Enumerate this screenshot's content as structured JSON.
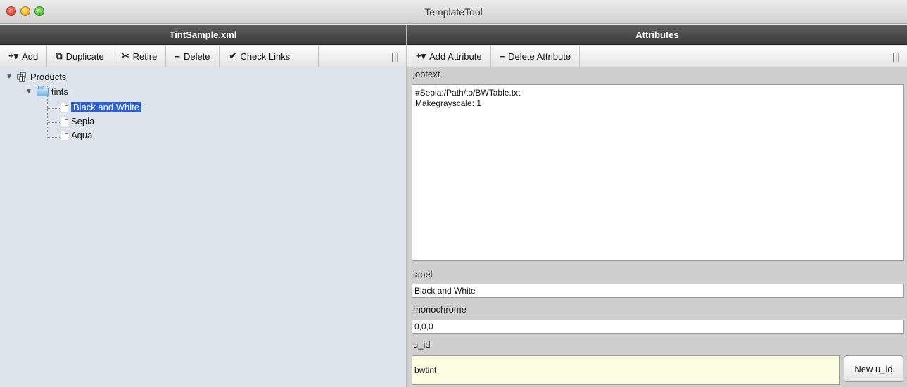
{
  "window": {
    "title": "TemplateTool"
  },
  "left_panel": {
    "title": "TintSample.xml",
    "toolbar": [
      {
        "icon": "plus-dropdown-icon",
        "glyph": "+▾",
        "label": "Add"
      },
      {
        "icon": "duplicate-icon",
        "glyph": "⧉",
        "label": "Duplicate"
      },
      {
        "icon": "retire-icon",
        "glyph": "✂",
        "label": "Retire"
      },
      {
        "icon": "minus-icon",
        "glyph": "−",
        "label": "Delete"
      },
      {
        "icon": "check-icon",
        "glyph": "✔",
        "label": "Check Links"
      }
    ],
    "grip": "|||",
    "tree": {
      "root": "Products",
      "folder": "tints",
      "items": [
        "Black and White",
        "Sepia",
        "Aqua"
      ],
      "selected": "Black and White"
    }
  },
  "right_panel": {
    "title": "Attributes",
    "toolbar": [
      {
        "icon": "plus-dropdown-icon",
        "glyph": "+▾",
        "label": "Add Attribute"
      },
      {
        "icon": "minus-icon",
        "glyph": "−",
        "label": "Delete Attribute"
      }
    ],
    "grip": "|||",
    "fields": {
      "jobtext": {
        "label": "jobtext",
        "value": "#Sepia:/Path/to/BWTable.txt\nMakegrayscale: 1"
      },
      "label": {
        "label": "label",
        "value": "Black and White"
      },
      "monochrome": {
        "label": "monochrome",
        "value": "0,0,0"
      },
      "u_id": {
        "label": "u_id",
        "value": "bwtint",
        "button": "New u_id"
      }
    }
  },
  "colors": {
    "selection": "#2f5fd0",
    "tree_background": "#dee4ec",
    "uid_background": "#fdfde2"
  }
}
